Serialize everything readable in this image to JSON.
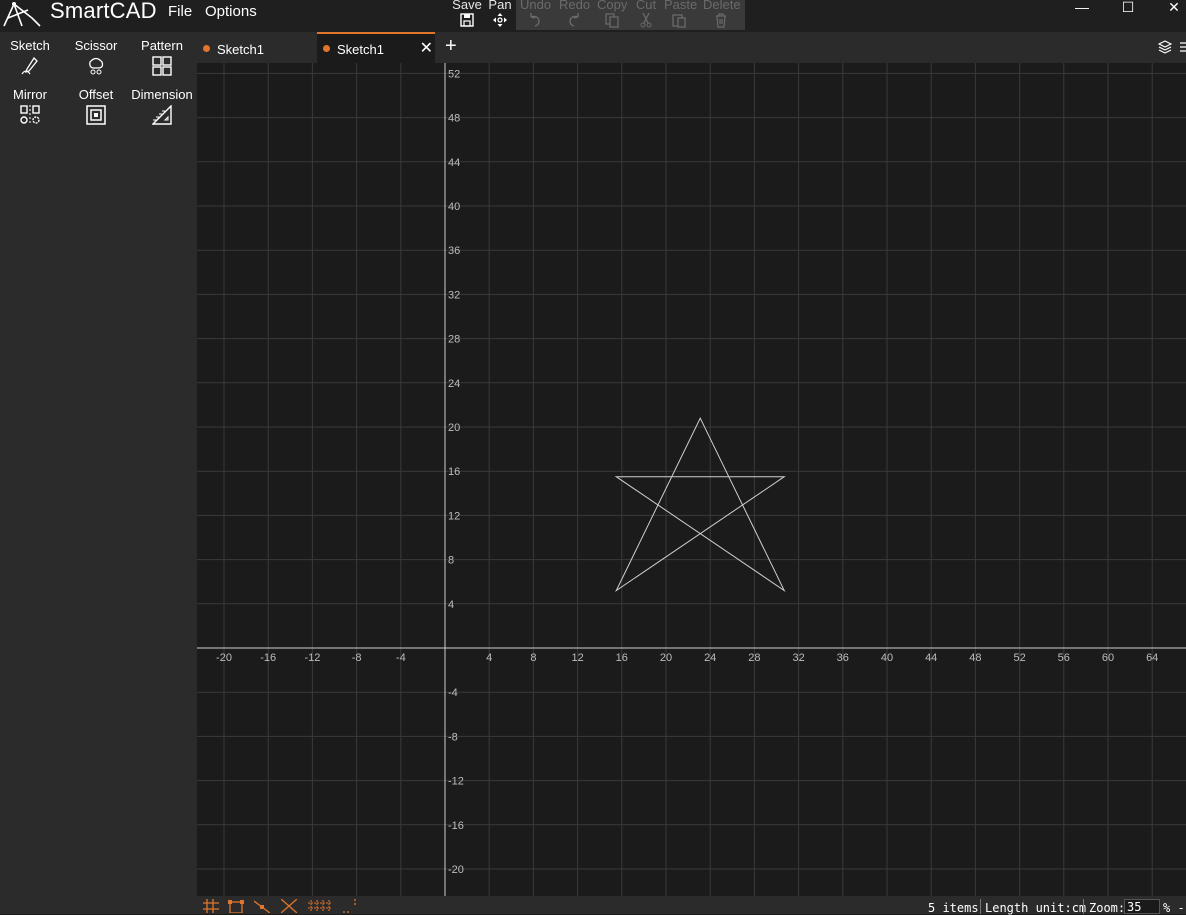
{
  "app": {
    "title": "SmartCAD"
  },
  "menu": {
    "file": "File",
    "options": "Options"
  },
  "toolbar": {
    "save": "Save",
    "pan": "Pan",
    "undo": "Undo",
    "redo": "Redo",
    "copy": "Copy",
    "cut": "Cut",
    "paste": "Paste",
    "delete": "Delete"
  },
  "window_controls": {
    "minimize": "—",
    "maximize": "☐",
    "close": "✕"
  },
  "tools": [
    {
      "label": "Sketch",
      "icon": "sketch-icon"
    },
    {
      "label": "Scissor",
      "icon": "scissor-icon"
    },
    {
      "label": "Pattern",
      "icon": "pattern-icon"
    },
    {
      "label": "Mirror",
      "icon": "mirror-icon"
    },
    {
      "label": "Offset",
      "icon": "offset-icon"
    },
    {
      "label": "Dimension",
      "icon": "dimension-icon"
    }
  ],
  "tabs": [
    {
      "label": "Sketch1",
      "active": false
    },
    {
      "label": "Sketch1",
      "active": true
    }
  ],
  "canvas": {
    "x_ticks": [
      -20,
      -16,
      -12,
      -8,
      -4,
      4,
      8,
      12,
      16,
      20,
      24,
      28,
      32,
      36,
      40,
      44,
      48,
      52,
      56,
      60,
      64
    ],
    "y_ticks": [
      52,
      48,
      44,
      40,
      36,
      32,
      28,
      24,
      20,
      16,
      12,
      8,
      4,
      -4,
      -8,
      -12,
      -16,
      -20
    ],
    "grid_step": 4,
    "accent_color": "#e0762c",
    "sketch_color": "#cfcfcf",
    "star_vertices": [
      [
        23.1,
        20.8
      ],
      [
        30.7,
        5.2
      ],
      [
        15.5,
        15.5
      ],
      [
        30.7,
        15.5
      ],
      [
        15.5,
        5.2
      ]
    ]
  },
  "status": {
    "items": "5 items",
    "length_unit": "Length unit:cm",
    "zoom_label": "Zoom:",
    "zoom_value": "35",
    "zoom_suffix": "% -"
  }
}
